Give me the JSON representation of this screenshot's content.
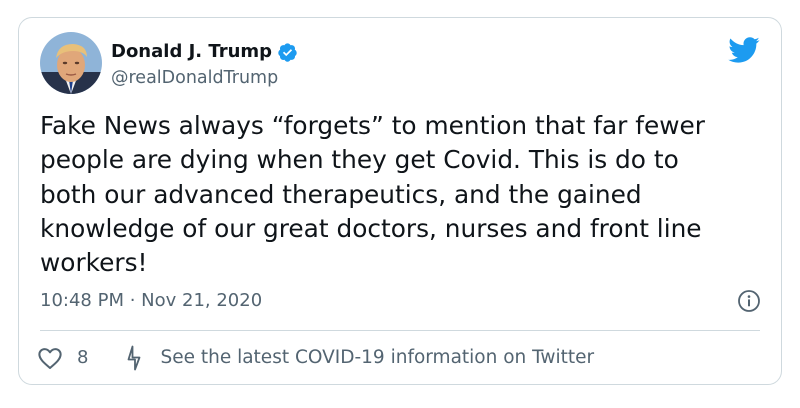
{
  "tweet": {
    "author": {
      "display_name": "Donald J. Trump",
      "handle": "@realDonaldTrump",
      "verified": true,
      "avatar_icon": "profile-photo"
    },
    "text": "Fake News always “forgets” to mention that far fewer\npeople are dying when they get Covid. This is do to\nboth our advanced therapeutics, and the gained\nknowledge of our great doctors, nurses and front line\nworkers!",
    "timestamp": "10:48 PM · Nov 21, 2020",
    "like_count": "8",
    "covid_link_label": "See the latest COVID-19 information on Twitter"
  },
  "icons": {
    "brand": "twitter-bird-icon",
    "verified": "verified-badge-icon",
    "info": "info-icon",
    "like": "heart-icon",
    "covid": "lightning-bolt-icon"
  },
  "colors": {
    "twitter_blue": "#1d9bf0",
    "text_primary": "#0f1419",
    "text_secondary": "#536471",
    "border": "#cfd9de"
  }
}
